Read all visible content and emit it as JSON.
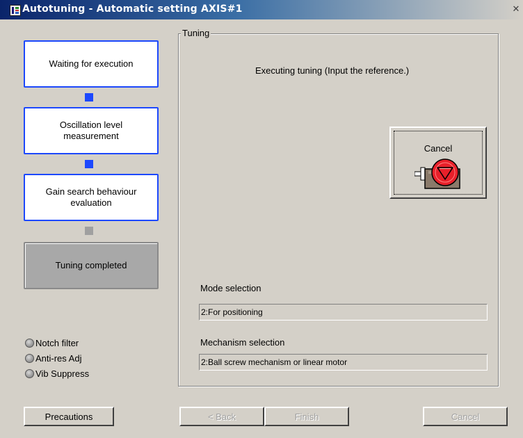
{
  "window": {
    "title": "Autotuning - Automatic setting AXIS#1",
    "close_glyph": "✕"
  },
  "steps": [
    {
      "label": "Waiting for execution",
      "state": "active"
    },
    {
      "label": "Oscillation level measurement",
      "state": "active"
    },
    {
      "label": "Gain search behaviour evaluation",
      "state": "active"
    },
    {
      "label": "Tuning completed",
      "state": "inactive"
    }
  ],
  "indicators": [
    {
      "label": "Notch filter",
      "on": false
    },
    {
      "label": "Anti-res Adj",
      "on": false
    },
    {
      "label": "Vib Suppress",
      "on": false
    }
  ],
  "tuning": {
    "group_label": "Tuning",
    "status": "Executing tuning (Input the reference.)",
    "cancel_label": "Cancel",
    "mode_label": "Mode selection",
    "mode_value": "2:For positioning",
    "mechanism_label": "Mechanism selection",
    "mechanism_value": "2:Ball screw mechanism or linear motor"
  },
  "buttons": {
    "precautions": "Precautions",
    "back": "< Back",
    "finish": "Finish",
    "cancel": "Cancel"
  },
  "colors": {
    "step_border_active": "#1c48ff",
    "step_inactive_bg": "#a8a8a8",
    "stop_icon_red": "#e8202a"
  },
  "icons": {
    "app": "app-icon",
    "close": "close-icon",
    "motor_stop": "motor-stop-icon"
  }
}
